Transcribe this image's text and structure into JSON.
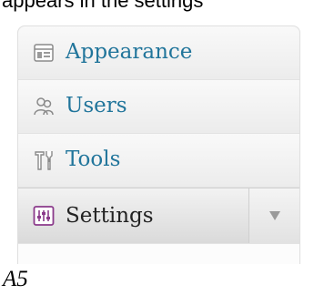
{
  "header": {
    "partial_text": "appears in the settings"
  },
  "menu": {
    "items": [
      {
        "label": "Appearance",
        "icon": "appearance-icon"
      },
      {
        "label": "Users",
        "icon": "users-icon"
      },
      {
        "label": "Tools",
        "icon": "tools-icon"
      },
      {
        "label": "Settings",
        "icon": "settings-icon",
        "active": true,
        "toggle_icon": "chevron-down-icon"
      }
    ]
  },
  "footer": {
    "page_label": "A5"
  },
  "colors": {
    "link": "#21759b",
    "active_text": "#222222",
    "settings_icon": "#8b3a8b"
  }
}
